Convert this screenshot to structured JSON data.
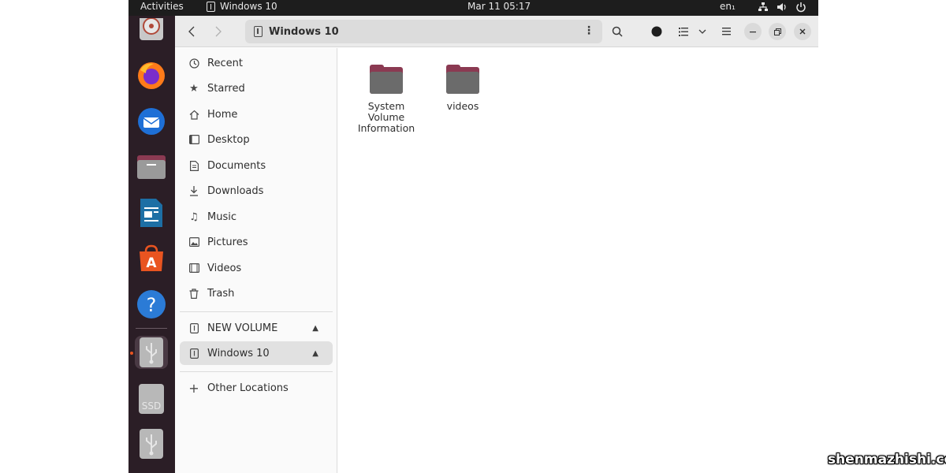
{
  "topbar": {
    "activities": "Activities",
    "app_name": "Windows 10",
    "clock": "Mar 11  05:17",
    "language": "en₁"
  },
  "dock": {
    "items": [
      {
        "name": "disk-utility-icon"
      },
      {
        "name": "firefox-icon"
      },
      {
        "name": "thunderbird-icon"
      },
      {
        "name": "files-icon"
      },
      {
        "name": "libreoffice-writer-icon"
      },
      {
        "name": "ubuntu-software-icon"
      },
      {
        "name": "help-icon"
      },
      {
        "name": "usb-drive-icon"
      },
      {
        "name": "ssd-drive-icon",
        "label": "SSD"
      },
      {
        "name": "usb-drive-icon"
      }
    ]
  },
  "headerbar": {
    "location": "Windows 10"
  },
  "sidebar": {
    "places": [
      {
        "label": "Recent",
        "icon": "clock-icon"
      },
      {
        "label": "Starred",
        "icon": "star-icon"
      },
      {
        "label": "Home",
        "icon": "home-icon"
      },
      {
        "label": "Desktop",
        "icon": "desktop-icon"
      },
      {
        "label": "Documents",
        "icon": "document-icon"
      },
      {
        "label": "Downloads",
        "icon": "download-icon"
      },
      {
        "label": "Music",
        "icon": "music-icon"
      },
      {
        "label": "Pictures",
        "icon": "picture-icon"
      },
      {
        "label": "Videos",
        "icon": "video-icon"
      },
      {
        "label": "Trash",
        "icon": "trash-icon"
      }
    ],
    "devices": [
      {
        "label": "NEW VOLUME",
        "icon": "usb-icon"
      },
      {
        "label": "Windows 10",
        "icon": "usb-icon",
        "selected": true
      }
    ],
    "other": {
      "label": "Other Locations",
      "icon": "plus-icon"
    }
  },
  "content": {
    "files": [
      {
        "name": "System Volume Information",
        "line1": "System",
        "line2": "Volume",
        "line3": "Information",
        "type": "folder"
      },
      {
        "name": "videos",
        "line1": "videos",
        "type": "folder"
      }
    ]
  },
  "colors": {
    "accent": "#e95420",
    "folder_top": "#8b3a52",
    "folder_body": "#6b6b6b",
    "dock_bg": "#2b1e26",
    "topbar_bg": "#1d1d1d"
  },
  "watermark": "shenmazhishi.com"
}
